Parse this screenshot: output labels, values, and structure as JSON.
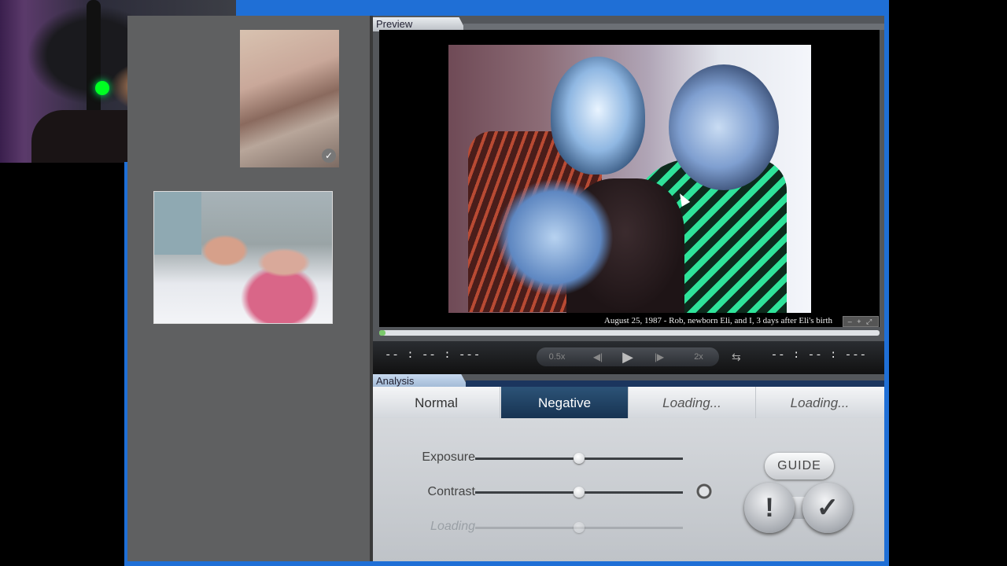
{
  "preview": {
    "header": "Preview",
    "caption": "August 25, 1987 - Rob, newborn Eli, and I, 3 days after Eli's birth",
    "zoom_controls": "– + ⤢"
  },
  "transport": {
    "time_left": "-- : -- : ---",
    "time_right": "-- : -- : ---",
    "speed_slow": "0.5x",
    "speed_fast": "2x",
    "icons": {
      "prev": "step-back-icon",
      "play": "play-icon",
      "next": "step-forward-icon",
      "loop": "loop-icon"
    }
  },
  "analysis": {
    "header": "Analysis",
    "modes": [
      {
        "label": "Normal",
        "active": false
      },
      {
        "label": "Negative",
        "active": true
      },
      {
        "label": "Loading...",
        "active": false
      },
      {
        "label": "Loading...",
        "active": false
      }
    ],
    "sliders": [
      {
        "label": "Exposure",
        "value": 0.5
      },
      {
        "label": "Contrast",
        "value": 0.5
      },
      {
        "label": "Loading",
        "value": 0.5,
        "disabled": true
      }
    ],
    "guide_label": "GUIDE",
    "warn_label": "!",
    "ok_label": "✓"
  },
  "thumbnails": [
    {
      "selected": false,
      "checked": true
    },
    {
      "selected": true
    }
  ],
  "colors": {
    "accent_blue": "#1f6fd6",
    "active_mode": "#1e3d5e",
    "seek_fill": "#7ac96b"
  }
}
